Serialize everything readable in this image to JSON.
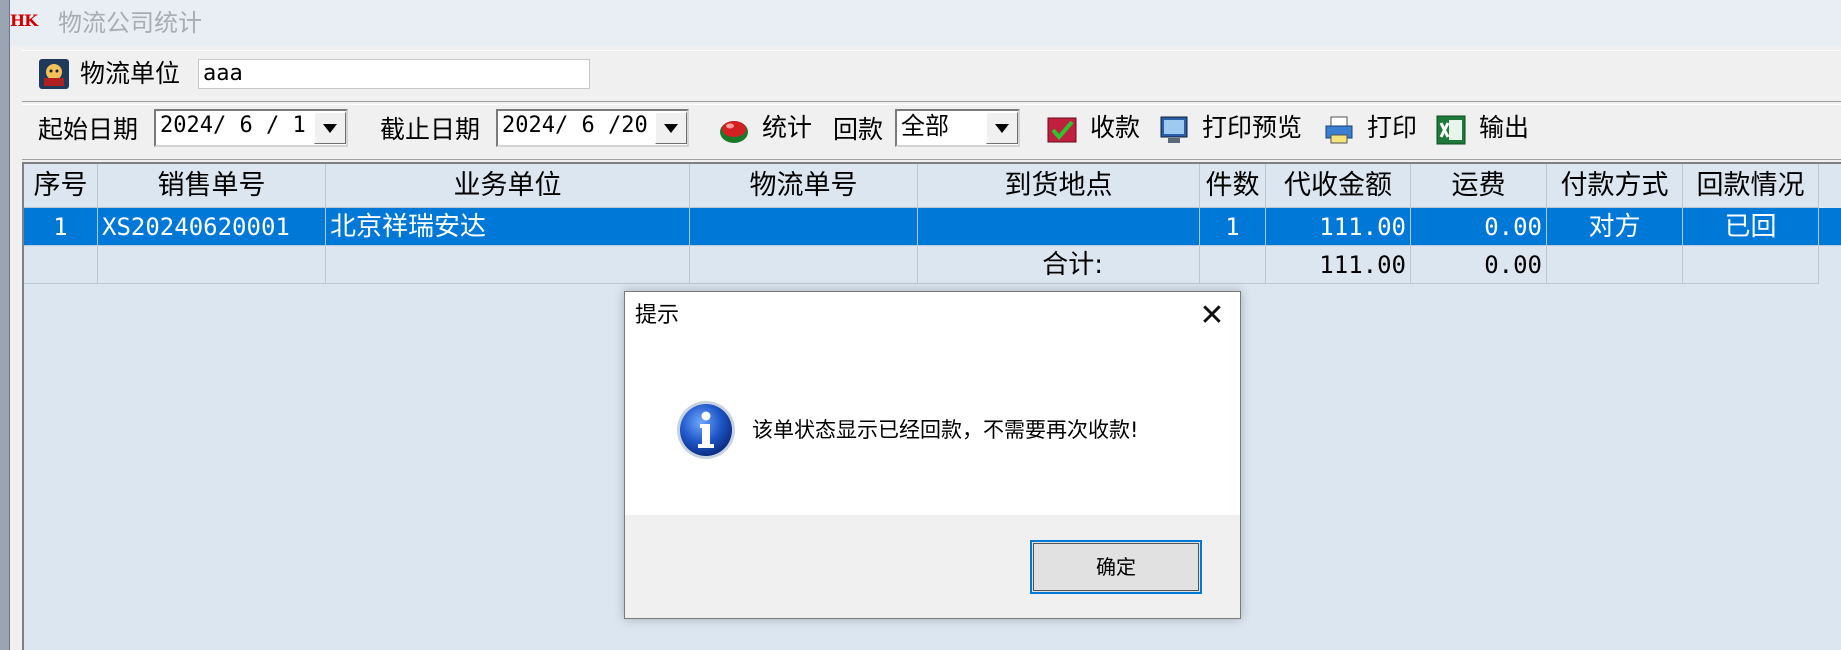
{
  "window": {
    "logo": "HK",
    "title": "物流公司统计"
  },
  "toolbar1": {
    "logistics_label": "物流单位",
    "logistics_value": "aaa"
  },
  "toolbar2": {
    "start_label": "起始日期",
    "start_value": "2024/ 6 / 1",
    "end_label": "截止日期",
    "end_value": "2024/ 6 /20",
    "stats_label": "统计",
    "refund_label": "回款",
    "refund_value": "全部",
    "receive_label": "收款",
    "preview_label": "打印预览",
    "print_label": "打印",
    "export_label": "输出"
  },
  "table": {
    "headers": [
      "序号",
      "销售单号",
      "业务单位",
      "物流单号",
      "到货地点",
      "件数",
      "代收金额",
      "运费",
      "付款方式",
      "回款情况"
    ],
    "rows": [
      [
        "1",
        "XS20240620001",
        "北京祥瑞安达",
        "",
        "",
        "1",
        "111.00",
        "0.00",
        "对方",
        "已回"
      ]
    ],
    "total_label": "合计:",
    "total_amount": "111.00",
    "total_freight": "0.00"
  },
  "dialog": {
    "title": "提示",
    "close_glyph": "✕",
    "message": "该单状态显示已经回款，不需要再次收款!",
    "ok_label": "确定"
  },
  "colors": {
    "selection": "#0078d7",
    "grid_bg": "#dce6f1",
    "logo": "#d10000"
  },
  "icons": [
    "logistics-icon",
    "stats-icon",
    "receive-icon",
    "print-preview-icon",
    "print-icon",
    "excel-export-icon",
    "info-icon",
    "close-icon",
    "dropdown-arrow-icon"
  ]
}
